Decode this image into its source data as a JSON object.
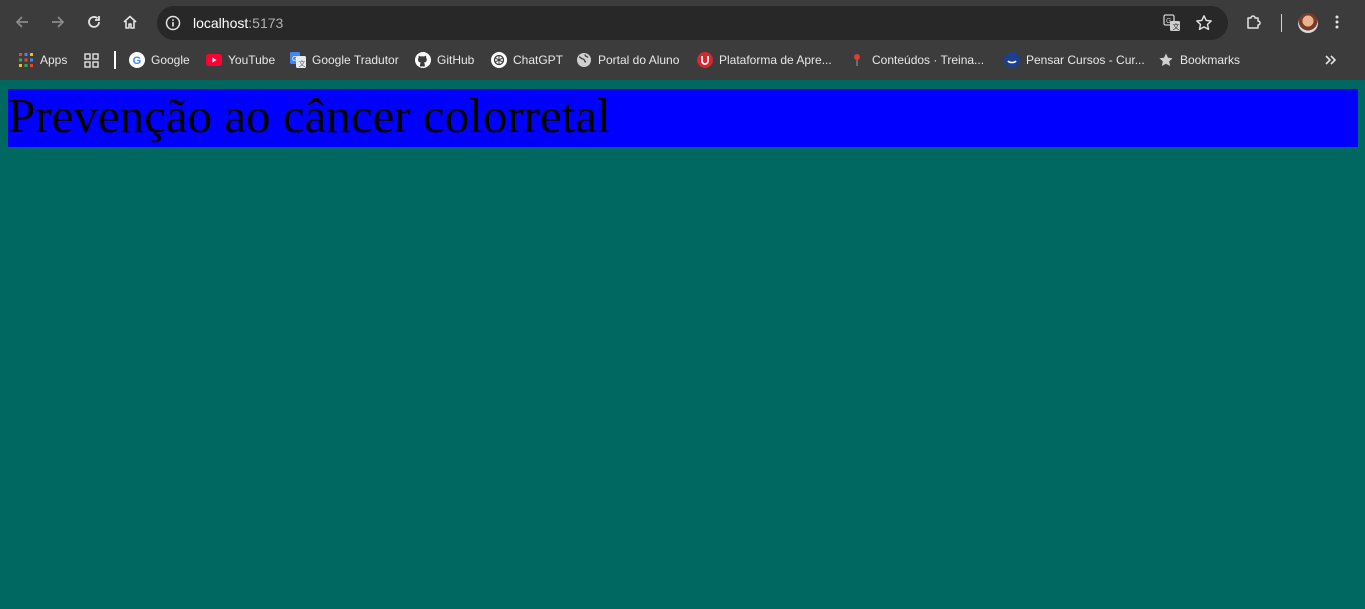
{
  "browser": {
    "url_host": "localhost",
    "url_port": ":5173",
    "bookmarks": [
      {
        "label": "Apps",
        "icon": "apps-grid-icon"
      },
      {
        "label": "Google",
        "icon": "google-icon"
      },
      {
        "label": "YouTube",
        "icon": "youtube-icon"
      },
      {
        "label": "Google Tradutor",
        "icon": "google-translate-icon"
      },
      {
        "label": "GitHub",
        "icon": "github-icon"
      },
      {
        "label": "ChatGPT",
        "icon": "chatgpt-icon"
      },
      {
        "label": "Portal do Aluno",
        "icon": "globe-icon"
      },
      {
        "label": "Plataforma de Apre...",
        "icon": "shield-u-icon"
      },
      {
        "label": "Conteúdos · Treina...",
        "icon": "pin-icon"
      },
      {
        "label": "Pensar Cursos - Cur...",
        "icon": "pensar-icon"
      },
      {
        "label": "Bookmarks",
        "icon": "star-icon"
      }
    ]
  },
  "page": {
    "heading": "Prevenção ao câncer colorretal",
    "background_color": "#006761",
    "banner_color": "#0000ff"
  }
}
